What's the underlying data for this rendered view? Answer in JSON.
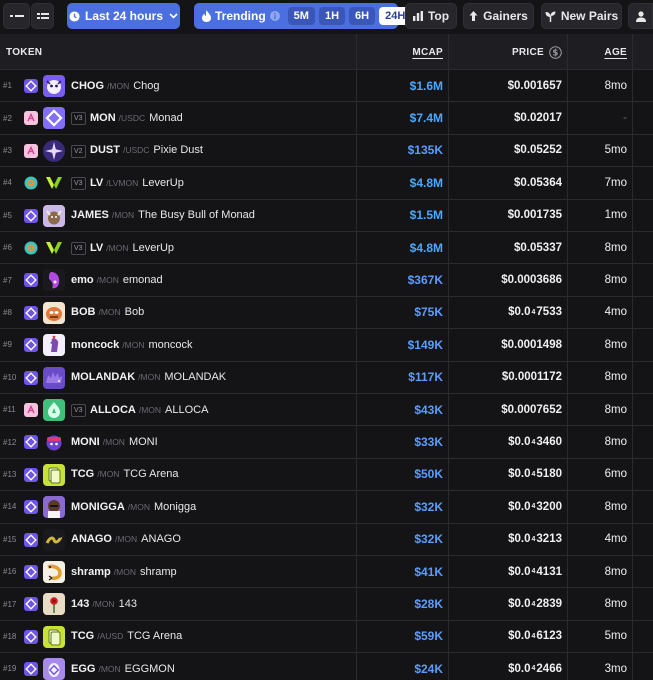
{
  "toolbar": {
    "timeframe_label": "Last 24 hours",
    "trending_label": "Trending",
    "intervals": [
      "5M",
      "1H",
      "6H",
      "24H"
    ],
    "active_interval": "24H",
    "top_label": "Top",
    "gainers_label": "Gainers",
    "new_pairs_label": "New Pairs"
  },
  "columns": {
    "token": "TOKEN",
    "mcap": "MCAP",
    "price": "PRICE",
    "age": "AGE"
  },
  "colors": {
    "accent_blue": "#4c6fe0",
    "mcap_blue": "#5b9dff",
    "background": "#141416"
  },
  "rows": [
    {
      "rank": "#1",
      "chain_icon": "monad-chain-icon",
      "dex_icon": "purple-diamond-icon",
      "version": "",
      "symbol": "CHOG",
      "quote": "MON",
      "name": "Chog",
      "mcap": "$1.6M",
      "price_pre": "$0.001657",
      "price_sub": "",
      "price_post": "",
      "age": "8mo",
      "logo_color": "#7b5cf0",
      "logo_icon": "chog-logo"
    },
    {
      "rank": "#2",
      "chain_icon": "monad-chain-icon",
      "dex_icon": "pink-swap-icon",
      "version": "V3",
      "symbol": "MON",
      "quote": "USDC",
      "name": "Monad",
      "mcap": "$7.4M",
      "price_pre": "$0.02017",
      "price_sub": "",
      "price_post": "",
      "age": "-",
      "logo_color": "#836ef9",
      "logo_icon": "monad-logo"
    },
    {
      "rank": "#3",
      "chain_icon": "monad-chain-icon",
      "dex_icon": "pink-swap-icon",
      "version": "V2",
      "symbol": "DUST",
      "quote": "USDC",
      "name": "Pixie Dust",
      "mcap": "$135K",
      "price_pre": "$0.05252",
      "price_sub": "",
      "price_post": "",
      "age": "5mo",
      "logo_color": "#3a2a7a",
      "logo_icon": "sparkle-logo"
    },
    {
      "rank": "#4",
      "chain_icon": "monad-chain-icon",
      "dex_icon": "orange-ring-icon",
      "version": "V3",
      "symbol": "LV",
      "quote": "LVMON",
      "name": "LeverUp",
      "mcap": "$4.8M",
      "price_pre": "$0.05364",
      "price_sub": "",
      "price_post": "",
      "age": "7mo",
      "logo_color": "#141416",
      "logo_icon": "leverup-logo"
    },
    {
      "rank": "#5",
      "chain_icon": "monad-chain-icon",
      "dex_icon": "purple-diamond-icon",
      "version": "",
      "symbol": "JAMES",
      "quote": "MON",
      "name": "The Busy Bull of Monad",
      "mcap": "$1.5M",
      "price_pre": "$0.001735",
      "price_sub": "",
      "price_post": "",
      "age": "1mo",
      "logo_color": "#c9b8e8",
      "logo_icon": "bull-logo"
    },
    {
      "rank": "#6",
      "chain_icon": "monad-chain-icon",
      "dex_icon": "orange-ring-icon",
      "version": "V3",
      "symbol": "LV",
      "quote": "MON",
      "name": "LeverUp",
      "mcap": "$4.8M",
      "price_pre": "$0.05337",
      "price_sub": "",
      "price_post": "",
      "age": "8mo",
      "logo_color": "#141416",
      "logo_icon": "leverup-logo"
    },
    {
      "rank": "#7",
      "chain_icon": "monad-chain-icon",
      "dex_icon": "purple-diamond-icon",
      "version": "",
      "symbol": "emo",
      "quote": "MON",
      "name": "emonad",
      "mcap": "$367K",
      "price_pre": "$0.0003686",
      "price_sub": "",
      "price_post": "",
      "age": "8mo",
      "logo_color": "#1a1a1e",
      "logo_icon": "emo-logo"
    },
    {
      "rank": "#8",
      "chain_icon": "monad-chain-icon",
      "dex_icon": "purple-diamond-icon",
      "version": "",
      "symbol": "BOB",
      "quote": "MON",
      "name": "Bob",
      "mcap": "$75K",
      "price_pre": "$0.0",
      "price_sub": "4",
      "price_post": "7533",
      "age": "4mo",
      "logo_color": "#e07a3a",
      "logo_icon": "bob-logo"
    },
    {
      "rank": "#9",
      "chain_icon": "monad-chain-icon",
      "dex_icon": "purple-diamond-icon",
      "version": "",
      "symbol": "moncock",
      "quote": "MON",
      "name": "moncock",
      "mcap": "$149K",
      "price_pre": "$0.0001498",
      "price_sub": "",
      "price_post": "",
      "age": "8mo",
      "logo_color": "#f2eefc",
      "logo_icon": "rooster-logo"
    },
    {
      "rank": "#10",
      "chain_icon": "monad-chain-icon",
      "dex_icon": "purple-diamond-icon",
      "version": "",
      "symbol": "MOLANDAK",
      "quote": "MON",
      "name": "MOLANDAK",
      "mcap": "$117K",
      "price_pre": "$0.0001172",
      "price_sub": "",
      "price_post": "",
      "age": "8mo",
      "logo_color": "#6b4cc8",
      "logo_icon": "hedgehog-logo"
    },
    {
      "rank": "#11",
      "chain_icon": "monad-chain-icon",
      "dex_icon": "pink-swap-icon",
      "version": "V3",
      "symbol": "ALLOCA",
      "quote": "MON",
      "name": "ALLOCA",
      "mcap": "$43K",
      "price_pre": "$0.0007652",
      "price_sub": "",
      "price_post": "",
      "age": "8mo",
      "logo_color": "#3fbf7a",
      "logo_icon": "alloca-logo"
    },
    {
      "rank": "#12",
      "chain_icon": "monad-chain-icon",
      "dex_icon": "purple-diamond-icon",
      "version": "",
      "symbol": "MONI",
      "quote": "MON",
      "name": "MONI",
      "mcap": "$33K",
      "price_pre": "$0.0",
      "price_sub": "4",
      "price_post": "3460",
      "age": "8mo",
      "logo_color": "#141416",
      "logo_icon": "moni-logo"
    },
    {
      "rank": "#13",
      "chain_icon": "monad-chain-icon",
      "dex_icon": "purple-diamond-icon",
      "version": "",
      "symbol": "TCG",
      "quote": "MON",
      "name": "TCG Arena",
      "mcap": "$50K",
      "price_pre": "$0.0",
      "price_sub": "4",
      "price_post": "5180",
      "age": "6mo",
      "logo_color": "#c8e03a",
      "logo_icon": "tcg-logo"
    },
    {
      "rank": "#14",
      "chain_icon": "monad-chain-icon",
      "dex_icon": "purple-diamond-icon",
      "version": "",
      "symbol": "MONIGGA",
      "quote": "MON",
      "name": "Monigga",
      "mcap": "$32K",
      "price_pre": "$0.0",
      "price_sub": "4",
      "price_post": "3200",
      "age": "8mo",
      "logo_color": "#8a6ad0",
      "logo_icon": "monigga-logo"
    },
    {
      "rank": "#15",
      "chain_icon": "monad-chain-icon",
      "dex_icon": "purple-diamond-icon",
      "version": "",
      "symbol": "ANAGO",
      "quote": "MON",
      "name": "ANAGO",
      "mcap": "$32K",
      "price_pre": "$0.0",
      "price_sub": "4",
      "price_post": "3213",
      "age": "4mo",
      "logo_color": "#1a1a1e",
      "logo_icon": "anago-logo"
    },
    {
      "rank": "#16",
      "chain_icon": "monad-chain-icon",
      "dex_icon": "purple-diamond-icon",
      "version": "",
      "symbol": "shramp",
      "quote": "MON",
      "name": "shramp",
      "mcap": "$41K",
      "price_pre": "$0.0",
      "price_sub": "4",
      "price_post": "4131",
      "age": "8mo",
      "logo_color": "#f4f1e4",
      "logo_icon": "shrimp-logo"
    },
    {
      "rank": "#17",
      "chain_icon": "monad-chain-icon",
      "dex_icon": "purple-diamond-icon",
      "version": "",
      "symbol": "143",
      "quote": "MON",
      "name": "143",
      "mcap": "$28K",
      "price_pre": "$0.0",
      "price_sub": "4",
      "price_post": "2839",
      "age": "8mo",
      "logo_color": "#e8dcc4",
      "logo_icon": "rose-logo"
    },
    {
      "rank": "#18",
      "chain_icon": "monad-chain-icon",
      "dex_icon": "purple-diamond-icon",
      "version": "",
      "symbol": "TCG",
      "quote": "AUSD",
      "name": "TCG Arena",
      "mcap": "$59K",
      "price_pre": "$0.0",
      "price_sub": "4",
      "price_post": "6123",
      "age": "5mo",
      "logo_color": "#c8e03a",
      "logo_icon": "tcg-logo"
    },
    {
      "rank": "#19",
      "chain_icon": "monad-chain-icon",
      "dex_icon": "purple-diamond-icon",
      "version": "",
      "symbol": "EGG",
      "quote": "MON",
      "name": "EGGMON",
      "mcap": "$24K",
      "price_pre": "$0.0",
      "price_sub": "4",
      "price_post": "2466",
      "age": "3mo",
      "logo_color": "#a88ae8",
      "logo_icon": "egg-logo"
    }
  ]
}
